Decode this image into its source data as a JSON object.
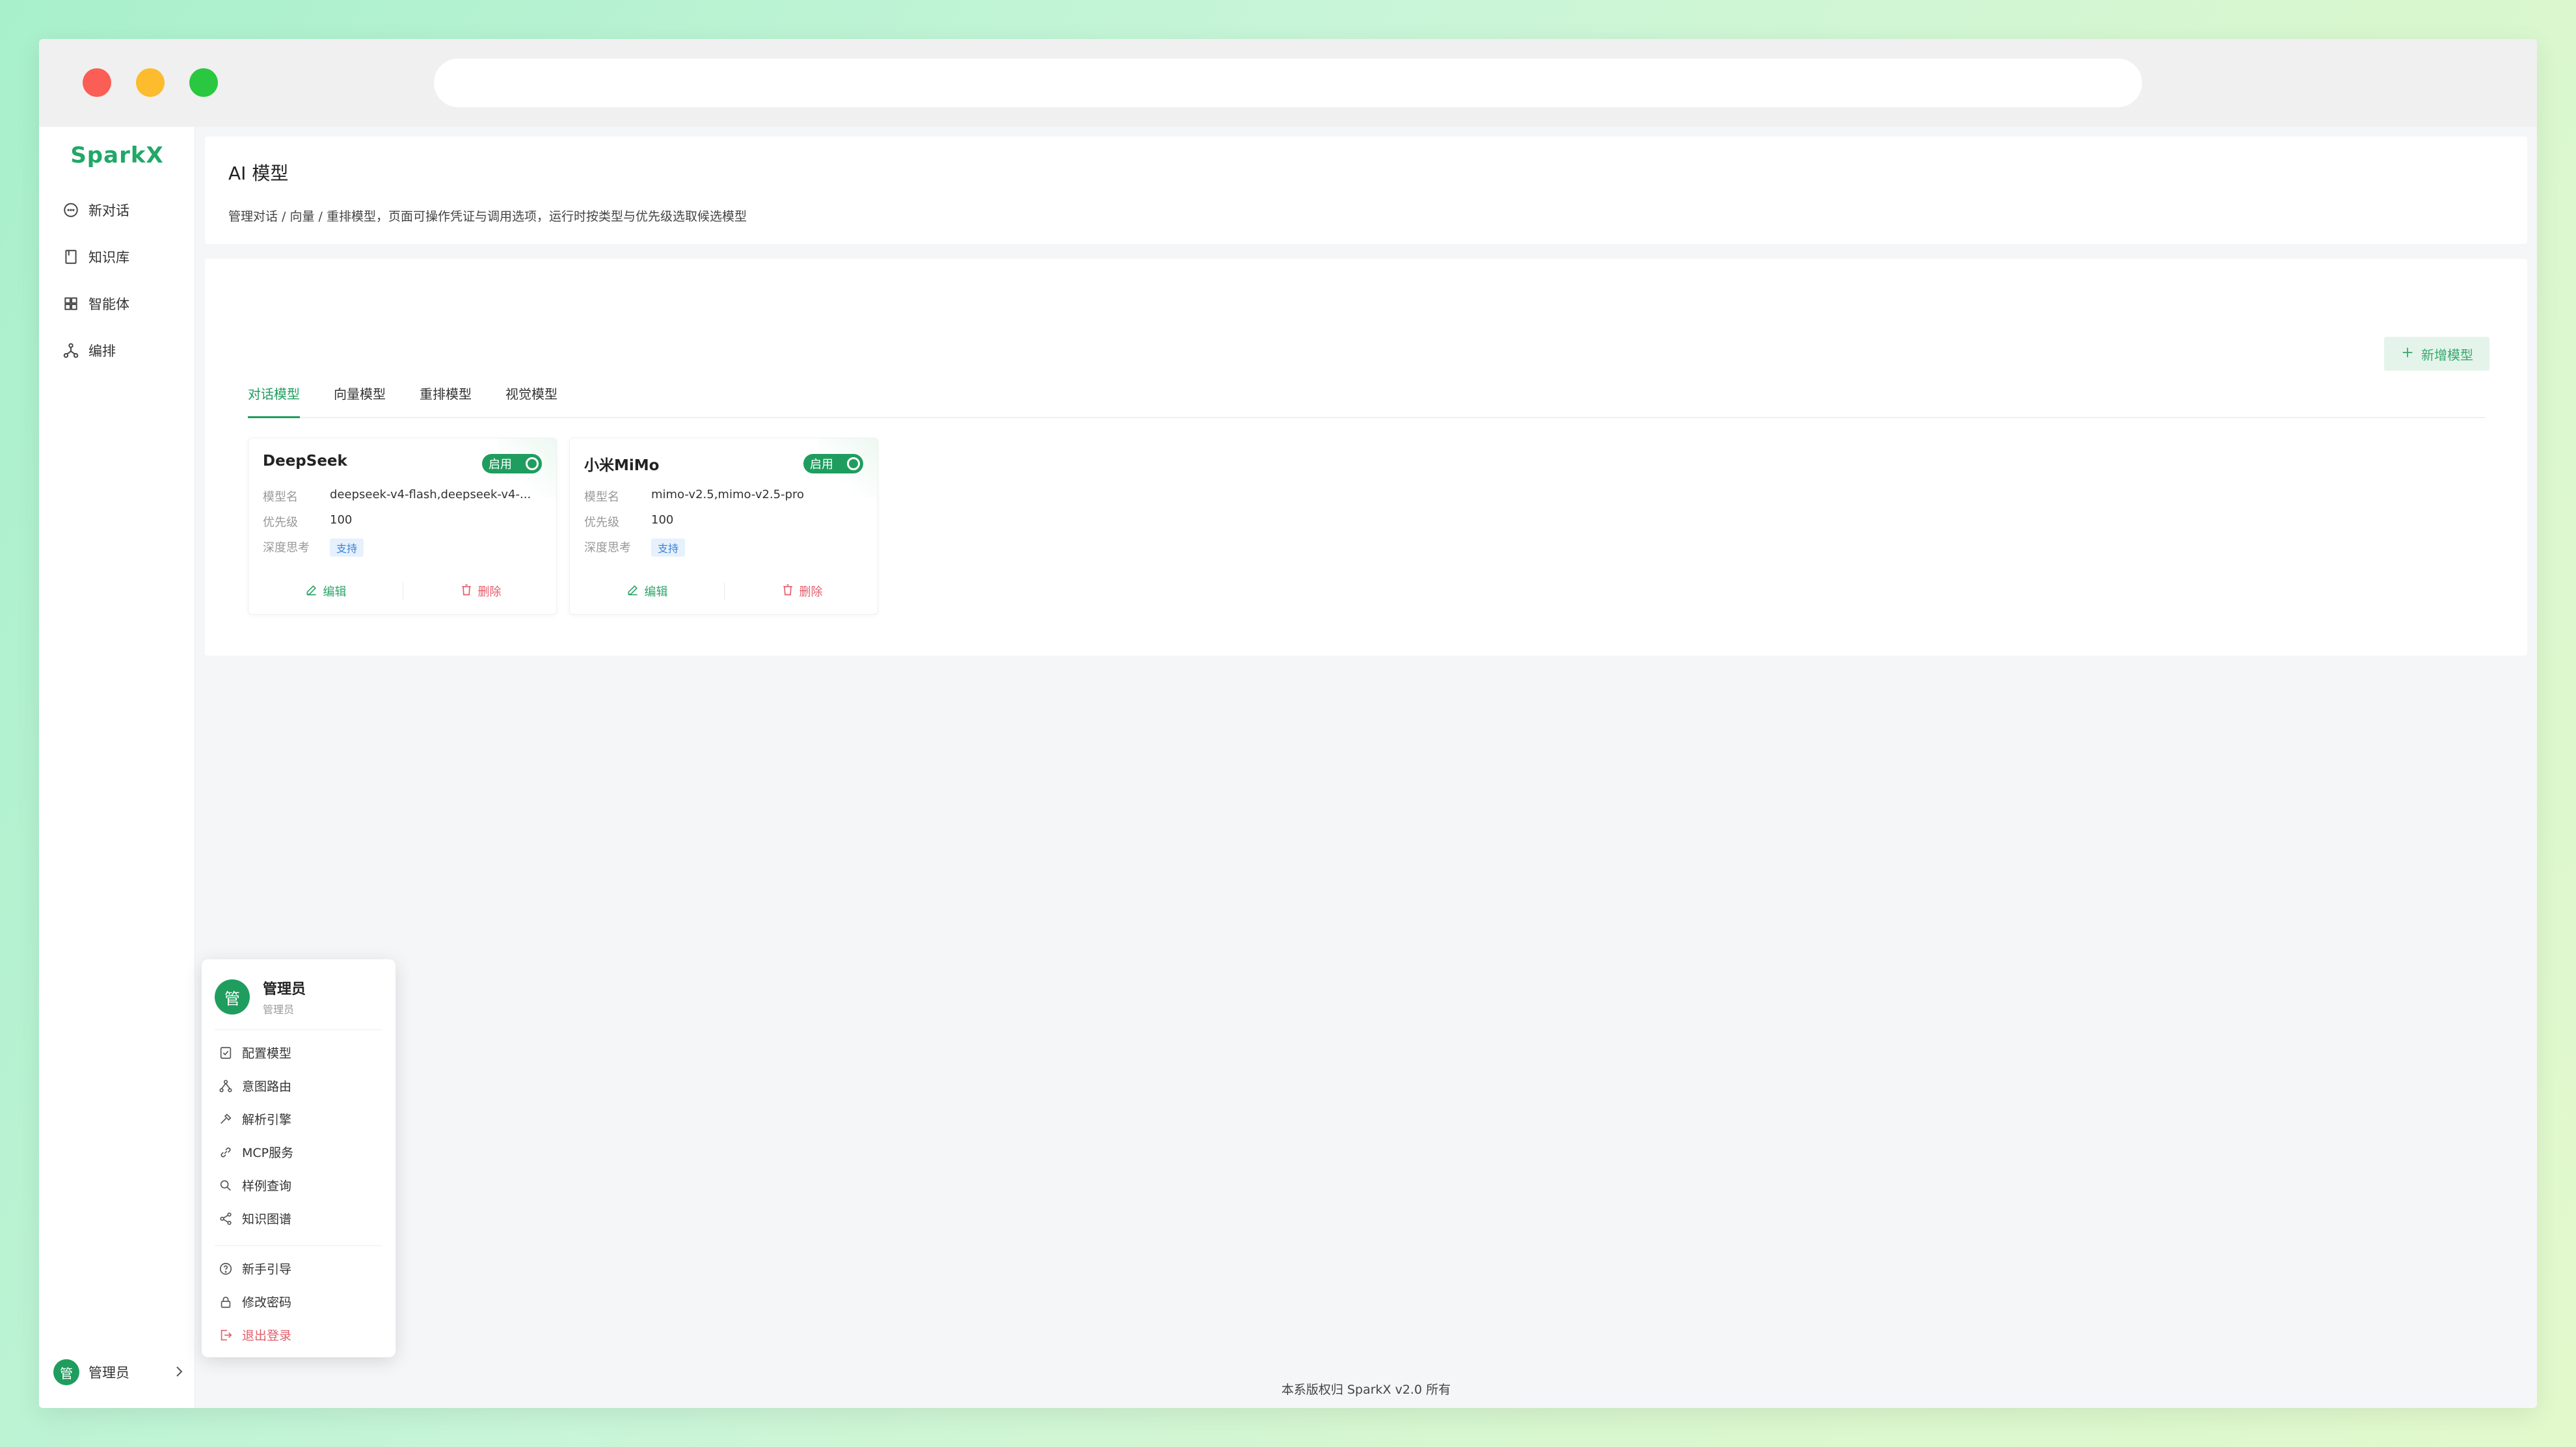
{
  "window": {
    "colors": {
      "close": "#fb5e55",
      "minimize": "#fdbb2e",
      "maximize": "#29c840"
    }
  },
  "sidebar": {
    "logo": "SparkX",
    "items": [
      {
        "label": "新对话",
        "icon": "chat-icon"
      },
      {
        "label": "知识库",
        "icon": "book-icon"
      },
      {
        "label": "智能体",
        "icon": "grid-icon"
      },
      {
        "label": "编排",
        "icon": "workflow-icon"
      }
    ],
    "user": {
      "avatar": "管",
      "name": "管理员"
    }
  },
  "header": {
    "title": "AI 模型",
    "subtitle": "管理对话 / 向量 / 重排模型，页面可操作凭证与调用选项，运行时按类型与优先级选取候选模型"
  },
  "main": {
    "add_button": "新增模型",
    "tabs": [
      {
        "label": "对话模型",
        "active": true
      },
      {
        "label": "向量模型",
        "active": false
      },
      {
        "label": "重排模型",
        "active": false
      },
      {
        "label": "视觉模型",
        "active": false
      }
    ],
    "models": [
      {
        "name": "DeepSeek",
        "status": "启用",
        "enabled": true,
        "fields": [
          {
            "label": "模型名",
            "value": "deepseek-v4-flash,deepseek-v4-..."
          },
          {
            "label": "优先级",
            "value": "100"
          },
          {
            "label": "深度思考",
            "tag": "支持"
          }
        ],
        "edit": "编辑",
        "delete": "删除"
      },
      {
        "name": "小米MiMo",
        "status": "启用",
        "enabled": true,
        "fields": [
          {
            "label": "模型名",
            "value": "mimo-v2.5,mimo-v2.5-pro"
          },
          {
            "label": "优先级",
            "value": "100"
          },
          {
            "label": "深度思考",
            "tag": "支持"
          }
        ],
        "edit": "编辑",
        "delete": "删除"
      }
    ]
  },
  "dropdown": {
    "avatar": "管",
    "name": "管理员",
    "role": "管理员",
    "items": [
      {
        "label": "配置模型",
        "icon": "config-icon"
      },
      {
        "label": "意图路由",
        "icon": "route-icon"
      },
      {
        "label": "解析引擎",
        "icon": "hammer-icon"
      },
      {
        "label": "MCP服务",
        "icon": "link-icon"
      },
      {
        "label": "样例查询",
        "icon": "search-icon"
      },
      {
        "label": "知识图谱",
        "icon": "share-icon"
      }
    ],
    "items2": [
      {
        "label": "新手引导",
        "icon": "help-icon"
      },
      {
        "label": "修改密码",
        "icon": "lock-icon"
      },
      {
        "label": "退出登录",
        "icon": "logout-icon"
      }
    ]
  },
  "footer": "本系版权归 SparkX v2.0 所有",
  "colors": {
    "brand": "#1f9d5f",
    "danger": "#e35d6a",
    "tag_blue": "#3b82d6"
  }
}
